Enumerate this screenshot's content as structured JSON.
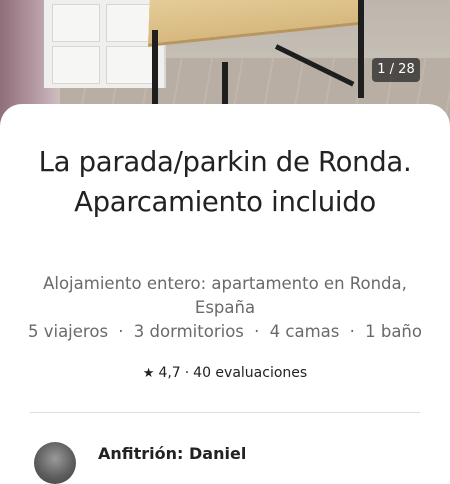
{
  "photo": {
    "counter": "1 / 28"
  },
  "listing": {
    "title": "La parada/parkin de Ronda. Aparcamiento incluido",
    "subtitle": "Alojamiento entero: apartamento en Ronda, España",
    "facts": [
      "5 viajeros",
      "3 dormitorios",
      "4 camas",
      "1 baño"
    ],
    "fact_separator": "·",
    "rating": {
      "star_icon": "star-icon",
      "score": "4,7",
      "separator": "·",
      "reviews": "40 evaluaciones"
    }
  },
  "host": {
    "name": "Anfitrión: Daniel"
  },
  "colors": {
    "text_primary": "#222222",
    "text_secondary": "#6a6a6a",
    "divider": "#dddddd"
  }
}
